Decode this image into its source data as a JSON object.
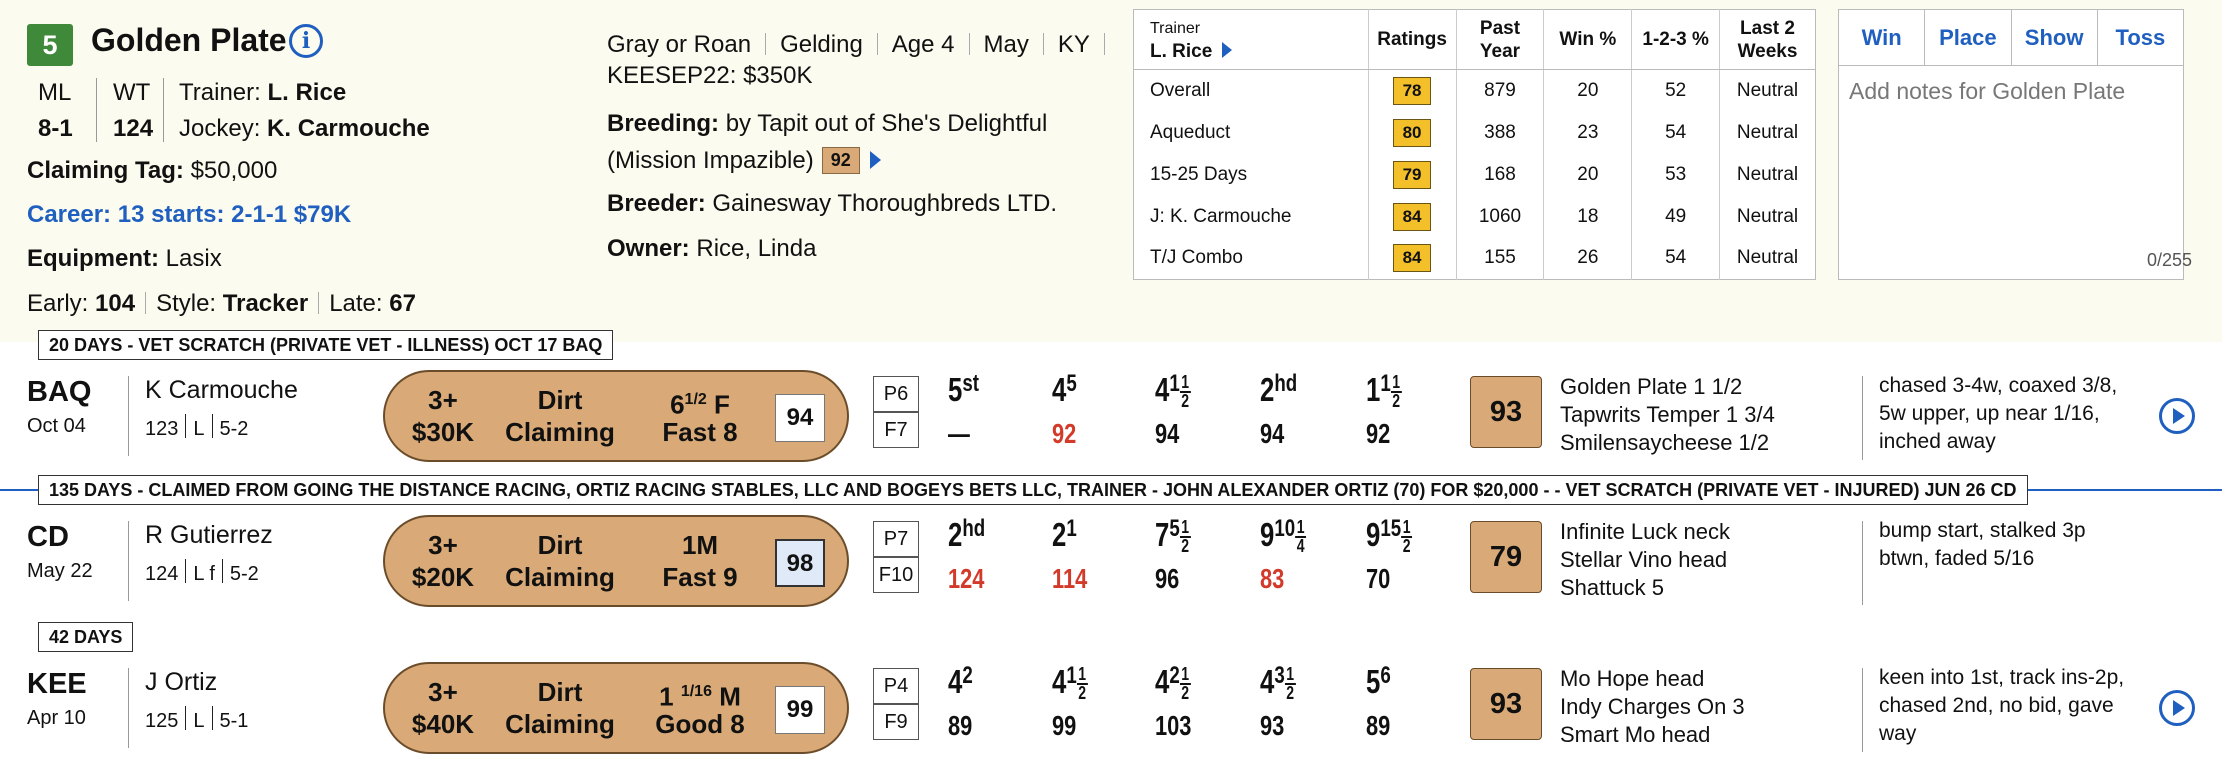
{
  "horse": {
    "program_number": "5",
    "name": "Golden Plate",
    "ml_label": "ML",
    "ml_odds": "8-1",
    "wt_label": "WT",
    "weight": "124",
    "trainer_label": "Trainer:",
    "trainer": "L. Rice",
    "jockey_label": "Jockey:",
    "jockey": "K. Carmouche",
    "claiming_label": "Claiming Tag:",
    "claiming": "$50,000",
    "career_label": "Career:",
    "career": "13 starts: 2-1-1 $79K",
    "equipment_label": "Equipment:",
    "equipment": "Lasix",
    "early_label": "Early:",
    "early": "104",
    "style_label": "Style:",
    "style": "Tracker",
    "late_label": "Late:",
    "late": "67"
  },
  "details": {
    "color": "Gray or Roan",
    "sex": "Gelding",
    "age": "Age 4",
    "foal_month": "May",
    "state": "KY",
    "sale": "KEESEP22: $350K",
    "breeding_label": "Breeding:",
    "breeding_line1": "by Tapit out of She's Delightful",
    "breeding_line2": "(Mission Impazible)",
    "breeding_rating": "92",
    "breeder_label": "Breeder:",
    "breeder": "Gainesway Thoroughbreds LTD.",
    "owner_label": "Owner:",
    "owner": "Rice, Linda"
  },
  "trainer_stats": {
    "trainer_caption": "Trainer",
    "trainer_name": "L. Rice",
    "headers": [
      "Ratings",
      "Past Year",
      "Win %",
      "1-2-3 %",
      "Last 2 Weeks"
    ],
    "rows": [
      {
        "label": "Overall",
        "rating": "78",
        "past_year": "879",
        "win": "20",
        "itm": "52",
        "last2": "Neutral"
      },
      {
        "label": "Aqueduct",
        "rating": "80",
        "past_year": "388",
        "win": "23",
        "itm": "54",
        "last2": "Neutral"
      },
      {
        "label": "15-25 Days",
        "rating": "79",
        "past_year": "168",
        "win": "20",
        "itm": "53",
        "last2": "Neutral"
      },
      {
        "label": "J: K. Carmouche",
        "rating": "84",
        "past_year": "1060",
        "win": "18",
        "itm": "49",
        "last2": "Neutral"
      },
      {
        "label": "T/J Combo",
        "rating": "84",
        "past_year": "155",
        "win": "26",
        "itm": "54",
        "last2": "Neutral"
      }
    ]
  },
  "wager": {
    "win": "Win",
    "place": "Place",
    "show": "Show",
    "toss": "Toss"
  },
  "notes": {
    "placeholder": "Add notes for Golden Plate",
    "count": "0/255"
  },
  "pp_notes": {
    "note1": "20 DAYS - VET SCRATCH (PRIVATE VET - ILLNESS) OCT 17 BAQ",
    "note2": "135 DAYS - CLAIMED FROM GOING THE DISTANCE RACING, ORTIZ RACING STABLES, LLC AND BOGEYS BETS LLC, TRAINER - JOHN ALEXANDER ORTIZ (70) FOR $20,000 - - VET SCRATCH (PRIVATE VET - INJURED) JUN 26 CD",
    "note3": "42 DAYS"
  },
  "races": [
    {
      "track": "BAQ",
      "date": "Oct 04",
      "jockey": "K Carmouche",
      "weight": "123",
      "med": "L",
      "odds": "5-2",
      "age": "3+",
      "purse": "$30K",
      "surface": "Dirt",
      "race_type": "Claiming",
      "dist_whole": "6",
      "dist_num": "1",
      "dist_den": "2",
      "dist_unit": "F",
      "condition": "Fast 8",
      "speed": "94",
      "post": "P6",
      "field": "F7",
      "calls": [
        {
          "pos": "5",
          "sup": "st",
          "margin": "",
          "fig": "—",
          "red": false
        },
        {
          "pos": "4",
          "sup": "5",
          "margin": "",
          "fig": "92",
          "red": true
        },
        {
          "pos": "4",
          "sup": "1",
          "margin_num": "1",
          "margin_den": "2",
          "fig": "94",
          "red": false
        },
        {
          "pos": "2",
          "sup": "hd",
          "margin": "",
          "fig": "94",
          "red": false
        },
        {
          "pos": "1",
          "sup": "1",
          "margin_num": "1",
          "margin_den": "2",
          "fig": "92",
          "red": false
        }
      ],
      "beyer": "93",
      "finishers": [
        "Golden Plate 1 1/2",
        "Tapwrits Temper 1 3/4",
        "Smilensaycheese 1/2"
      ],
      "comment": "chased 3-4w, coaxed 3/8, 5w upper, up near 1/16, inched away"
    },
    {
      "track": "CD",
      "date": "May 22",
      "jockey": "R Gutierrez",
      "weight": "124",
      "med": "L f",
      "odds": "5-2",
      "age": "3+",
      "purse": "$20K",
      "surface": "Dirt",
      "race_type": "Claiming",
      "dist_whole": "1M",
      "dist_num": "",
      "dist_den": "",
      "dist_unit": "",
      "condition": "Fast 9",
      "speed": "98",
      "post": "P7",
      "field": "F10",
      "calls": [
        {
          "pos": "2",
          "sup": "hd",
          "margin": "",
          "fig": "124",
          "red": true
        },
        {
          "pos": "2",
          "sup": "1",
          "margin": "",
          "fig": "114",
          "red": true
        },
        {
          "pos": "7",
          "sup": "5",
          "margin_num": "1",
          "margin_den": "2",
          "fig": "96",
          "red": false
        },
        {
          "pos": "9",
          "sup": "10",
          "margin_num": "1",
          "margin_den": "4",
          "fig": "83",
          "red": true
        },
        {
          "pos": "9",
          "sup": "15",
          "margin_num": "1",
          "margin_den": "2",
          "fig": "70",
          "red": false
        }
      ],
      "beyer": "79",
      "finishers": [
        "Infinite Luck neck",
        "Stellar Vino head",
        "Shattuck 5"
      ],
      "comment": "bump start, stalked 3p btwn, faded 5/16"
    },
    {
      "track": "KEE",
      "date": "Apr 10",
      "jockey": "J Ortiz",
      "weight": "125",
      "med": "L",
      "odds": "5-1",
      "age": "3+",
      "purse": "$40K",
      "surface": "Dirt",
      "race_type": "Claiming",
      "dist_whole": "1",
      "dist_num": "1/16",
      "dist_den": "",
      "dist_unit": "M",
      "condition": "Good 8",
      "speed": "99",
      "post": "P4",
      "field": "F9",
      "calls": [
        {
          "pos": "4",
          "sup": "2",
          "margin": "",
          "fig": "89",
          "red": false
        },
        {
          "pos": "4",
          "sup": "1",
          "margin_num": "1",
          "margin_den": "2",
          "fig": "99",
          "red": false
        },
        {
          "pos": "4",
          "sup": "2",
          "margin_num": "1",
          "margin_den": "2",
          "fig": "103",
          "red": false
        },
        {
          "pos": "4",
          "sup": "3",
          "margin_num": "1",
          "margin_den": "2",
          "fig": "93",
          "red": false
        },
        {
          "pos": "5",
          "sup": "6",
          "margin": "",
          "fig": "89",
          "red": false
        }
      ],
      "beyer": "93",
      "finishers": [
        "Mo Hope head",
        "Indy Charges On 3",
        "Smart Mo head"
      ],
      "comment": "keen into 1st, track ins-2p, chased 2nd, no bid, gave way"
    }
  ]
}
